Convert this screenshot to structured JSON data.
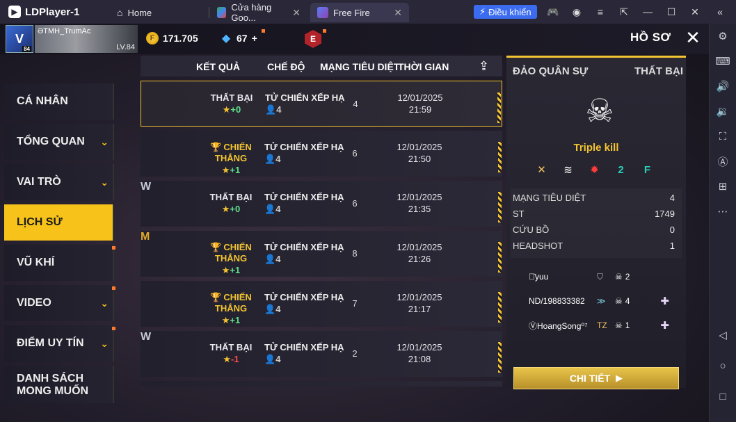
{
  "window": {
    "app_name": "LDPlayer-1",
    "tabs": [
      {
        "label": "Home",
        "icon": "home-icon"
      },
      {
        "label": "Cửa hàng Goo...",
        "icon": "play-store-icon"
      },
      {
        "label": "Free Fire",
        "icon": "free-fire-icon"
      }
    ],
    "control_button": "Điều khiển"
  },
  "player": {
    "avatar_label": "V",
    "avatar_level": "84",
    "name": "ƏTMH_TrumAc",
    "level": "LV.84"
  },
  "currency": {
    "coins": "171.705",
    "diamonds": "67",
    "diamonds_add": "+",
    "elite_badge": "E"
  },
  "header": {
    "title": "HỒ SƠ"
  },
  "menu": [
    {
      "label": "CÁ NHÂN",
      "chevron": false,
      "active": false
    },
    {
      "label": "TỔNG QUAN",
      "chevron": true,
      "active": false
    },
    {
      "label": "VAI TRÒ",
      "chevron": true,
      "active": false
    },
    {
      "label": "LỊCH SỬ",
      "chevron": false,
      "active": true
    },
    {
      "label": "VŨ KHÍ",
      "chevron": false,
      "active": false
    },
    {
      "label": "VIDEO",
      "chevron": true,
      "active": false
    },
    {
      "label": "ĐIỂM UY TÍN",
      "chevron": true,
      "active": false
    },
    {
      "label": "DANH SÁCH MONG MUỐN",
      "line1": "DANH SÁCH",
      "line2": "MONG MUỐN",
      "chevron": false,
      "active": false
    }
  ],
  "history": {
    "headers": {
      "result": "KẾT QUẢ",
      "mode": "CHẾ ĐỘ",
      "kills": "MẠNG TIÊU DIỆT",
      "time": "THỜI GIAN"
    },
    "rows": [
      {
        "result": "THẤT BẠI",
        "points": "+0",
        "mode": "TỬ CHIẾN XẾP HẠ",
        "players": "4",
        "kills": "4",
        "date": "12/01/2025",
        "time": "21:59"
      },
      {
        "result": "CHIẾN THẮNG",
        "points": "+1",
        "mode": "TỬ CHIẾN XẾP HẠ",
        "players": "4",
        "kills": "6",
        "date": "12/01/2025",
        "time": "21:50"
      },
      {
        "result": "THẤT BẠI",
        "points": "+0",
        "mode": "TỬ CHIẾN XẾP HẠ",
        "players": "4",
        "kills": "6",
        "date": "12/01/2025",
        "time": "21:35"
      },
      {
        "result": "CHIẾN THẮNG",
        "points": "+1",
        "mode": "TỬ CHIẾN XẾP HẠ",
        "players": "4",
        "kills": "8",
        "date": "12/01/2025",
        "time": "21:26"
      },
      {
        "result": "CHIẾN THẮNG",
        "points": "+1",
        "mode": "TỬ CHIẾN XẾP HẠ",
        "players": "4",
        "kills": "7",
        "date": "12/01/2025",
        "time": "21:17"
      },
      {
        "result": "THẤT BẠI",
        "points": "-1",
        "mode": "TỬ CHIẾN XẾP HẠ",
        "players": "4",
        "kills": "2",
        "date": "12/01/2025",
        "time": "21:08"
      }
    ]
  },
  "detail": {
    "map": "ĐẢO QUÂN SỰ",
    "result": "THẤT BẠI",
    "title": "Triple kill",
    "stats": [
      {
        "label": "MẠNG TIÊU DIỆT",
        "value": "4"
      },
      {
        "label": "ST",
        "value": "1749"
      },
      {
        "label": "CỨU BỒ",
        "value": "0"
      },
      {
        "label": "HEADSHOT",
        "value": "1"
      }
    ],
    "players": [
      {
        "name": "ခ̄yuu",
        "rank_icon": "shield-rank-icon",
        "kills": "2",
        "add": false
      },
      {
        "name": "ND/198833382",
        "rank_icon": "wing-rank-icon",
        "kills": "4",
        "add": true
      },
      {
        "name": "ⓋHoangSong⁰⁷",
        "rank_icon": "tz-rank-icon",
        "kills": "1",
        "add": true
      }
    ],
    "button": "CHI TIẾT"
  },
  "colors": {
    "accent": "#f3c431",
    "win": "#f3c431",
    "plus": "#5ee08a",
    "minus": "#ff4d4d"
  }
}
